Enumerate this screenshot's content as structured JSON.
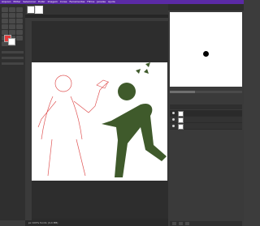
{
  "menubar": {
    "items": [
      "Arquivo",
      "Editar",
      "Selecionar",
      "Exibir",
      "Imagem",
      "Cores",
      "Ferramentas",
      "Filtros",
      "Janelas",
      "Ajuda"
    ]
  },
  "toolbox": {
    "tools": [
      "move-tool",
      "rect-select-tool",
      "ellipse-select-tool",
      "free-select-tool",
      "fuzzy-select-tool",
      "crop-tool",
      "transform-tool",
      "flip-tool",
      "paths-tool",
      "text-tool",
      "bucket-fill-tool",
      "gradient-tool",
      "paintbrush-tool",
      "eraser-tool",
      "clone-tool",
      "smudge-tool",
      "dodge-tool",
      "color-picker-tool",
      "measure-tool",
      "zoom-tool"
    ],
    "foreground_color": "#e23b3b",
    "background_color": "#ffffff"
  },
  "canvas": {
    "document_background": "#ffffff",
    "figure_fill": "#3f5a2b",
    "outline_color": "#e05454"
  },
  "statusbar": {
    "text": "px  100%  fundo (4,4 MB)"
  },
  "brushes": {
    "slider_fraction": 0.35
  },
  "layers": {
    "rows": [
      {
        "selected": true
      },
      {
        "selected": false
      },
      {
        "selected": false
      }
    ]
  }
}
